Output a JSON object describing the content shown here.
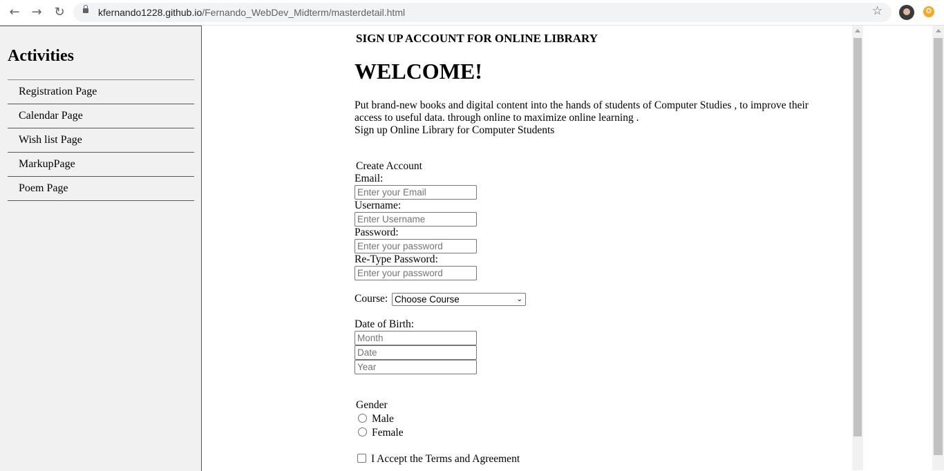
{
  "browser": {
    "url_host": "kfernando1228.github.io",
    "url_path": "/Fernando_WebDev_Midterm/masterdetail.html",
    "back_icon": "←",
    "forward_icon": "→",
    "reload_icon": "↻",
    "star_icon": "☆"
  },
  "sidebar": {
    "title": "Activities",
    "items": [
      {
        "label": "Registration Page"
      },
      {
        "label": "Calendar Page"
      },
      {
        "label": "Wish list Page"
      },
      {
        "label": "MarkupPage"
      },
      {
        "label": "Poem Page"
      }
    ]
  },
  "page": {
    "subheading": "SIGN UP ACCOUNT FOR ONLINE LIBRARY",
    "heading": "WELCOME!",
    "intro_line1": "Put brand-new books and digital content into the hands of students of Computer Studies , to improve their access to useful data. through online to maximize online learning .",
    "intro_line2": "Sign up Online Library for Computer Students"
  },
  "form": {
    "legend": "Create Account",
    "email_label": "Email:",
    "email_placeholder": "Enter your Email",
    "username_label": "Username:",
    "username_placeholder": "Enter Username",
    "password_label": "Password:",
    "password_placeholder": "Enter your password",
    "retype_label": "Re-Type Password:",
    "retype_placeholder": "Enter your password",
    "course_label": "Course:",
    "course_selected": "Choose Course",
    "dob_label": "Date of Birth:",
    "month_placeholder": "Month",
    "date_placeholder": "Date",
    "year_placeholder": "Year",
    "gender_label": "Gender",
    "gender_male": "Male",
    "gender_female": "Female",
    "terms_label": "I Accept the Terms and Agreement"
  }
}
